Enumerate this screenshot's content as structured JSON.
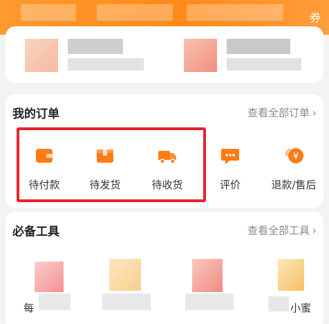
{
  "banner": {
    "right_text": "券"
  },
  "orders": {
    "title": "我的订单",
    "view_all": "查看全部订单",
    "items": [
      {
        "label": "待付款",
        "icon": "wallet-icon"
      },
      {
        "label": "待发货",
        "icon": "package-icon"
      },
      {
        "label": "待收货",
        "icon": "truck-icon"
      },
      {
        "label": "评价",
        "icon": "comment-icon"
      },
      {
        "label": "退款/售后",
        "icon": "refund-icon"
      }
    ]
  },
  "tools": {
    "title": "必备工具",
    "view_all": "查看全部工具",
    "items": [
      {
        "label": "每"
      },
      {
        "label": ""
      },
      {
        "label": ""
      },
      {
        "label": "小蜜"
      }
    ]
  },
  "colors": {
    "accent": "#ff8a1a",
    "icon": "#ff7a12",
    "highlight": "#e8232b"
  }
}
